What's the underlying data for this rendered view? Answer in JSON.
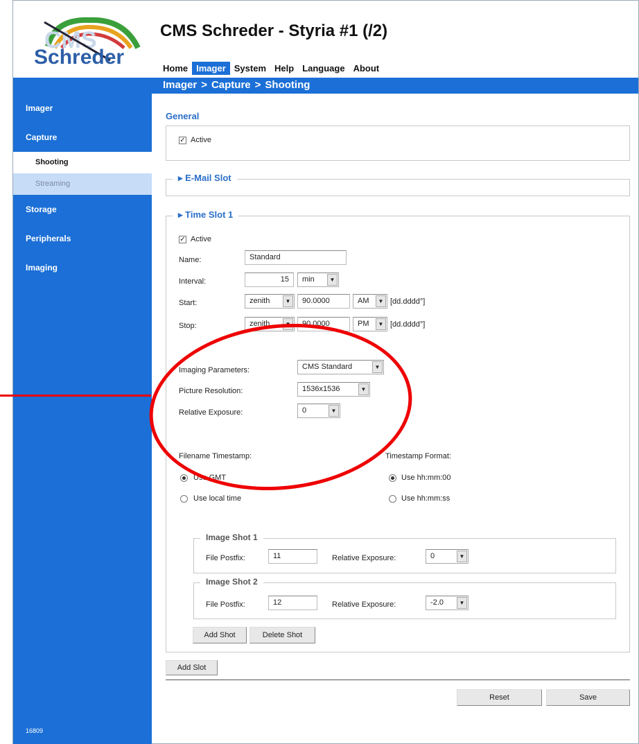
{
  "header": {
    "title": "CMS Schreder - Styria #1 (/2)",
    "logo_text": "Schreder"
  },
  "topnav": [
    "Home",
    "Imager",
    "System",
    "Help",
    "Language",
    "About"
  ],
  "breadcrumb": [
    "Imager",
    ">",
    "Capture",
    ">",
    "Shooting"
  ],
  "sidebar": {
    "items": [
      "Imager",
      "Capture",
      "Storage",
      "Peripherals",
      "Imaging"
    ],
    "sub": [
      "Shooting",
      "Streaming"
    ],
    "version": "16809"
  },
  "general": {
    "title": "General",
    "active_label": "Active"
  },
  "email": {
    "title": "E-Mail Slot"
  },
  "timeslot": {
    "title": "Time Slot 1",
    "active_label": "Active",
    "name_label": "Name:",
    "name_value": "Standard",
    "interval_label": "Interval:",
    "interval_value": "15",
    "interval_unit": "min",
    "start_label": "Start:",
    "start_ref": "zenith",
    "start_angle": "90.0000",
    "start_ampm": "AM",
    "format_hint": "[dd.dddd°]",
    "stop_label": "Stop:",
    "stop_ref": "zenith",
    "stop_angle": "90.0000",
    "stop_ampm": "PM",
    "imaging_label": "Imaging Parameters:",
    "imaging_value": "CMS Standard",
    "resolution_label": "Picture Resolution:",
    "resolution_value": "1536x1536",
    "exposure_label": "Relative Exposure:",
    "exposure_value": "0",
    "fn_ts_label": "Filename Timestamp:",
    "use_gmt": "Use GMT",
    "use_local": "Use local time",
    "ts_format_label": "Timestamp Format:",
    "fmt_00": "Use hh:mm:00",
    "fmt_ss": "Use hh:mm:ss",
    "shots": [
      {
        "title": "Image Shot 1",
        "postfix_label": "File Postfix:",
        "postfix": "11",
        "exp_label": "Relative Exposure:",
        "exp": "0"
      },
      {
        "title": "Image Shot 2",
        "postfix_label": "File Postfix:",
        "postfix": "12",
        "exp_label": "Relative Exposure:",
        "exp": "-2.0"
      }
    ],
    "add_shot": "Add Shot",
    "delete_shot": "Delete Shot"
  },
  "add_slot": "Add Slot",
  "reset": "Reset",
  "save": "Save",
  "colors": {
    "accent": "#1b6fd6",
    "heading": "#2a6ec8",
    "annotation": "#e00000"
  }
}
